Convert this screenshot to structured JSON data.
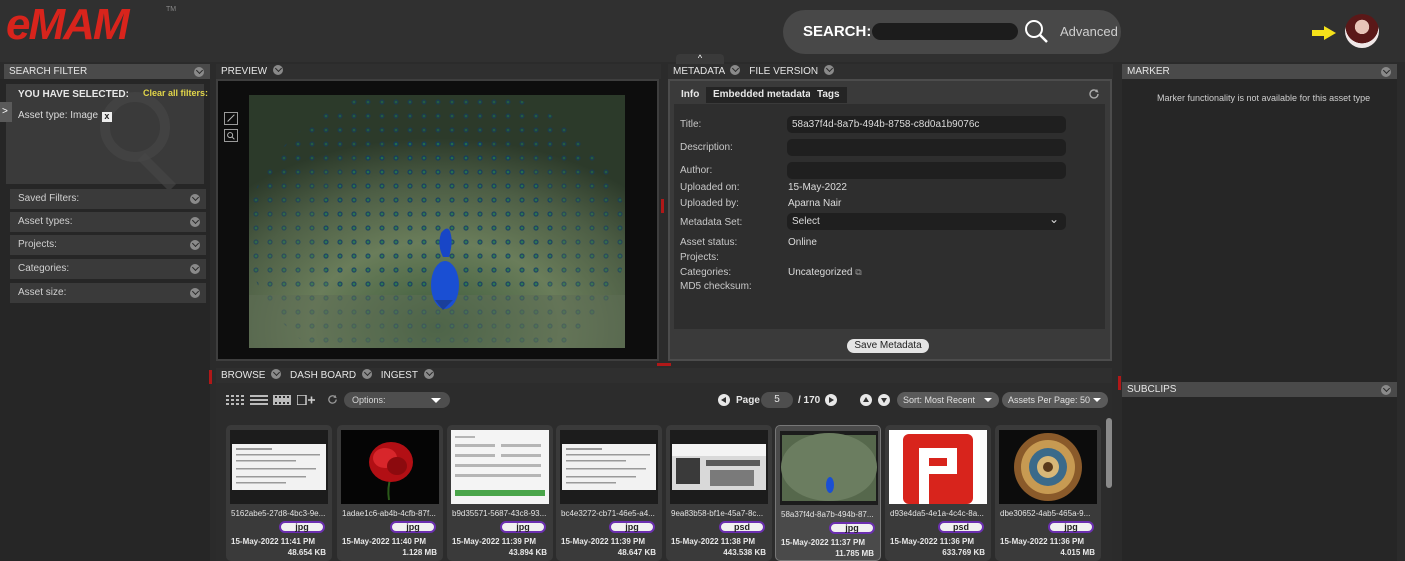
{
  "header": {
    "logo_text": "eMAM",
    "logo_tm": "TM",
    "search_label": "SEARCH:",
    "search_placeholder": "",
    "advanced_label": "Advanced"
  },
  "collapse_label": "^",
  "search_filter": {
    "title": "SEARCH FILTER",
    "you_have_selected": "YOU HAVE SELECTED:",
    "clear_all": "Clear all filters:",
    "selected_filter": "Asset type:  Image",
    "remove_label": "x",
    "toggle_label": ">",
    "rows": [
      {
        "label": "Saved Filters:"
      },
      {
        "label": "Asset types:"
      },
      {
        "label": "Projects:"
      },
      {
        "label": "Categories:"
      },
      {
        "label": "Asset size:"
      }
    ]
  },
  "preview": {
    "title": "PREVIEW"
  },
  "metadata": {
    "title": "METADATA",
    "file_version_title": "FILE VERSION",
    "tabs": [
      "Info",
      "Embedded metadata",
      "Tags"
    ],
    "labels": {
      "title": "Title:",
      "description": "Description:",
      "author": "Author:",
      "uploaded_on": "Uploaded on:",
      "uploaded_by": "Uploaded by:",
      "metadata_set": "Metadata Set:",
      "asset_status": "Asset status:",
      "projects": "Projects:",
      "categories": "Categories:",
      "md5": "MD5 checksum:"
    },
    "values": {
      "title": "58a37f4d-8a7b-494b-8758-c8d0a1b9076c",
      "description": "",
      "author": "",
      "uploaded_on": "15-May-2022",
      "uploaded_by": "Aparna Nair",
      "metadata_set": "Select",
      "asset_status": "Online",
      "categories": "Uncategorized"
    },
    "save_label": "Save Metadata"
  },
  "marker": {
    "title": "MARKER",
    "message": "Marker functionality is not available for this asset type"
  },
  "subclips": {
    "title": "SUBCLIPS"
  },
  "browse": {
    "tabs": [
      "BROWSE",
      "DASH BOARD",
      "INGEST"
    ],
    "options_label": "Options:",
    "page_label": "Page",
    "page_value": "5",
    "page_total": "/ 170",
    "sort_label": "Sort: Most Recent",
    "per_page_label": "Assets Per Page: 50",
    "assets": [
      {
        "name": "5162abe5-27d8-4bc3-9e...",
        "ext": "jpg",
        "date": "15-May-2022 11:41 PM",
        "size": "48.654 KB",
        "thumb": "doc"
      },
      {
        "name": "1adae1c6-ab4b-4cfb-87f...",
        "ext": "jpg",
        "date": "15-May-2022 11:40 PM",
        "size": "1.128 MB",
        "thumb": "rose"
      },
      {
        "name": "b9d35571-5687-43c8-93...",
        "ext": "jpg",
        "date": "15-May-2022 11:39 PM",
        "size": "43.894 KB",
        "thumb": "form"
      },
      {
        "name": "bc4e3272-cb71-46e5-a4...",
        "ext": "jpg",
        "date": "15-May-2022 11:39 PM",
        "size": "48.647 KB",
        "thumb": "doc"
      },
      {
        "name": "9ea83b58-bf1e-45a7-8c...",
        "ext": "psd",
        "date": "15-May-2022 11:38 PM",
        "size": "443.538 KB",
        "thumb": "kitchen"
      },
      {
        "name": "58a37f4d-8a7b-494b-87...",
        "ext": "jpg",
        "date": "15-May-2022 11:37 PM",
        "size": "11.785 MB",
        "thumb": "peacock"
      },
      {
        "name": "d93e4da5-4e1a-4c4c-8a...",
        "ext": "psd",
        "date": "15-May-2022 11:36 PM",
        "size": "633.769 KB",
        "thumb": "logo"
      },
      {
        "name": "dbe30652-4ab5-465a-9...",
        "ext": "jpg",
        "date": "15-May-2022 11:36 PM",
        "size": "4.015 MB",
        "thumb": "dome"
      }
    ]
  },
  "colors": {
    "brand_red": "#d8241c",
    "ext_badge_border": "#6b2fb0",
    "clear_filters": "#e2d64a",
    "arrow_yellow": "#f5e11a"
  }
}
